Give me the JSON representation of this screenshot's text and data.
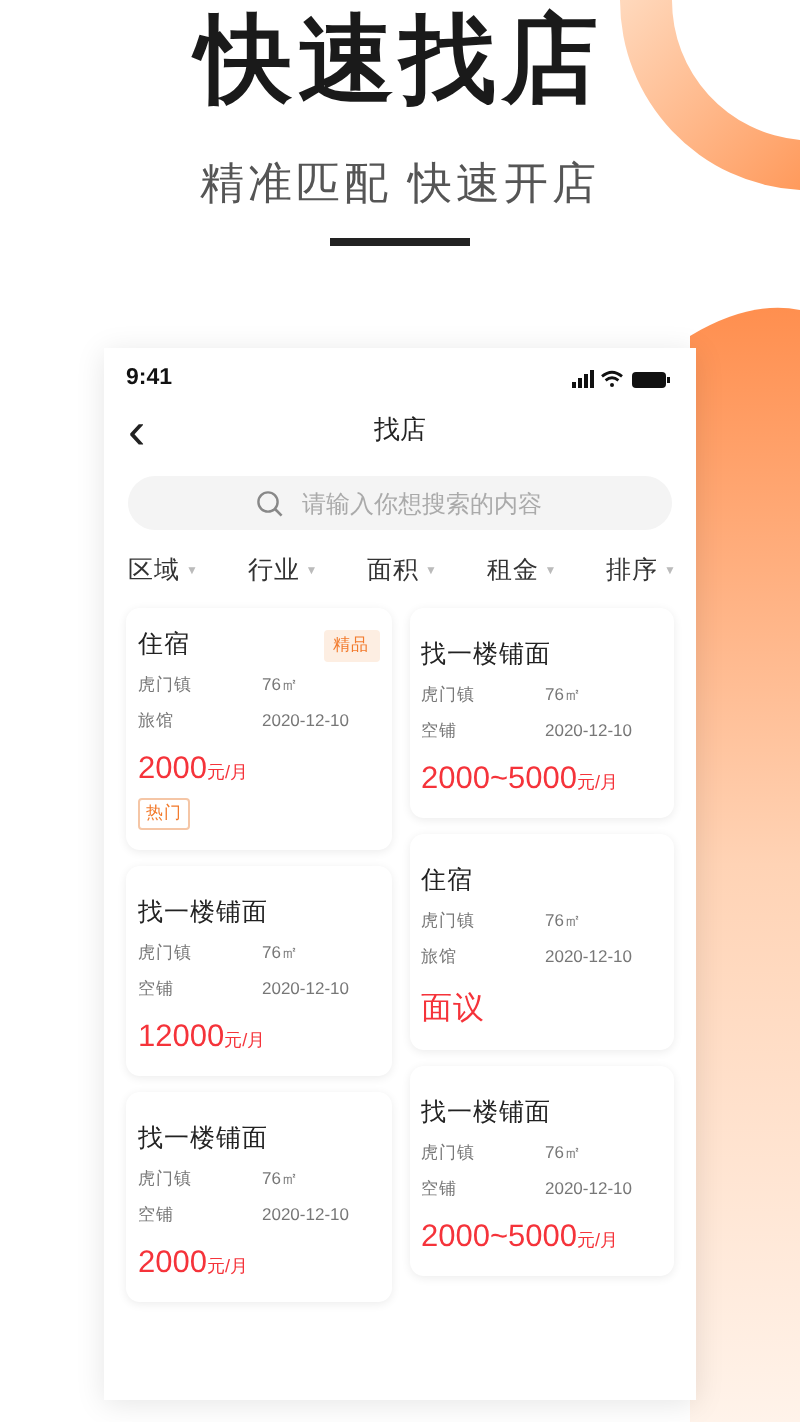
{
  "promo": {
    "headline": "快速找店",
    "subtitle": "精准匹配 快速开店"
  },
  "status_bar": {
    "time": "9:41"
  },
  "nav": {
    "back": "‹",
    "title": "找店"
  },
  "search": {
    "placeholder": "请输入你想搜索的内容"
  },
  "filters": [
    {
      "label": "区域",
      "arrow": "▼"
    },
    {
      "label": "行业",
      "arrow": "▼"
    },
    {
      "label": "面积",
      "arrow": "▼"
    },
    {
      "label": "租金",
      "arrow": "▼"
    },
    {
      "label": "排序",
      "arrow": "▼"
    }
  ],
  "card_columns": [
    {
      "cards": [
        {
          "title": "住宿",
          "badge": "精品",
          "district": "虎门镇",
          "area": "76㎡",
          "type": "旅馆",
          "date": "2020-12-10",
          "price": "2000",
          "unit": "元/月",
          "tag": "热门"
        },
        {
          "title": "找一楼铺面",
          "district": "虎门镇",
          "area": "76㎡",
          "type": "空铺",
          "date": "2020-12-10",
          "price": "12000",
          "unit": "元/月"
        },
        {
          "title": "找一楼铺面",
          "district": "虎门镇",
          "area": "76㎡",
          "type": "空铺",
          "date": "2020-12-10",
          "price": "2000",
          "unit": "元/月"
        }
      ]
    },
    {
      "cards": [
        {
          "title": "找一楼铺面",
          "district": "虎门镇",
          "area": "76㎡",
          "type": "空铺",
          "date": "2020-12-10",
          "price": "2000~5000",
          "unit": "元/月"
        },
        {
          "title": "住宿",
          "district": "虎门镇",
          "area": "76㎡",
          "type": "旅馆",
          "date": "2020-12-10",
          "price": "面议"
        },
        {
          "title": "找一楼铺面",
          "district": "虎门镇",
          "area": "76㎡",
          "type": "空铺",
          "date": "2020-12-10",
          "price": "2000~5000",
          "unit": "元/月"
        }
      ]
    }
  ]
}
